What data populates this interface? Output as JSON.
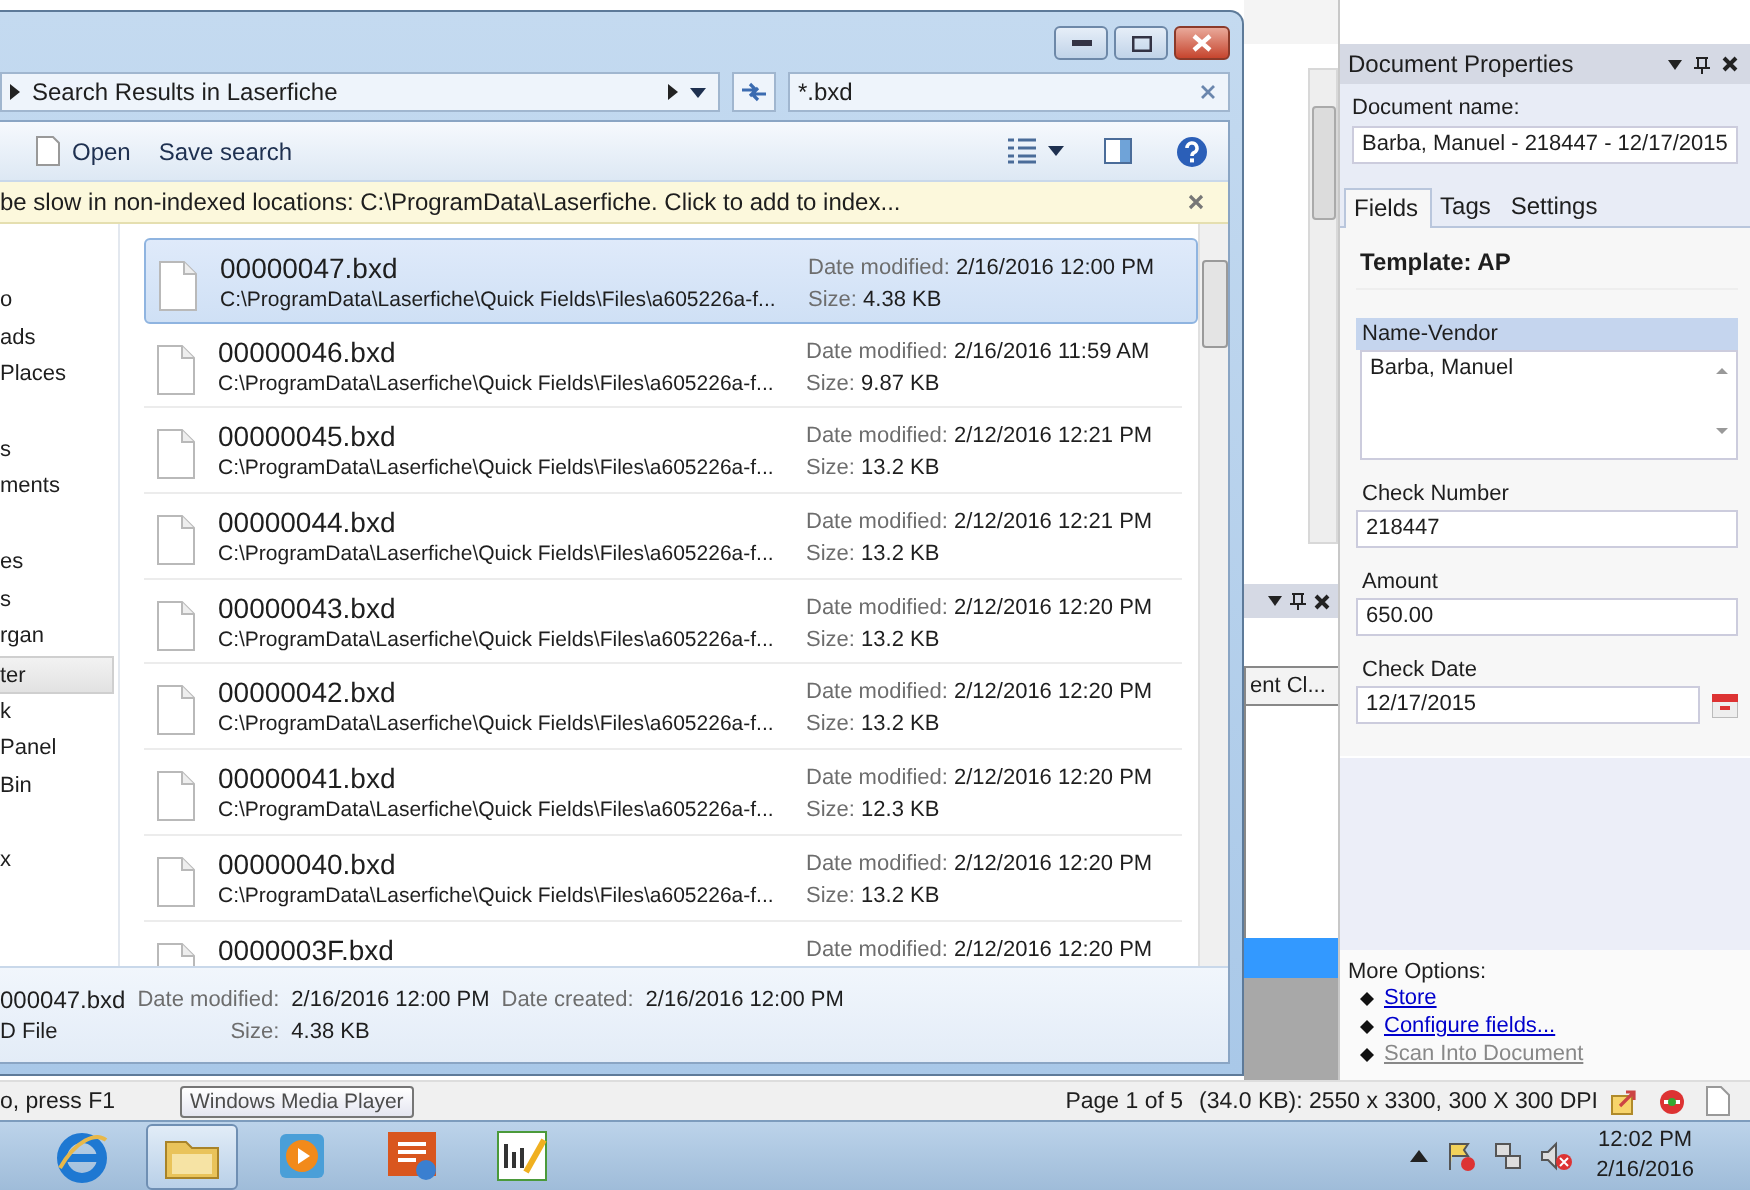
{
  "explorer": {
    "breadcrumb": "Search Results in Laserfiche",
    "search": {
      "value": "*.bxd"
    },
    "toolbar": [
      {
        "label": "Open",
        "kind": "open"
      },
      {
        "label": "Save search",
        "kind": "plain"
      }
    ],
    "info_bar": "be slow in non-indexed locations: C:\\ProgramData\\Laserfiche. Click to add to index...",
    "nav_groups": [
      {
        "items": [
          {
            "label": "o",
            "selected": false
          },
          {
            "label": "ads",
            "selected": false
          },
          {
            "label": "Places",
            "selected": false
          }
        ]
      },
      {
        "items": [
          {
            "label": "s",
            "selected": false
          },
          {
            "label": "ments",
            "selected": false
          }
        ]
      },
      {
        "items": [
          {
            "label": "es",
            "selected": false
          },
          {
            "label": "s",
            "selected": false
          },
          {
            "label": "rgan",
            "selected": false
          },
          {
            "label": "ter",
            "selected": true
          },
          {
            "label": "k",
            "selected": false
          },
          {
            "label": "Panel",
            "selected": false
          },
          {
            "label": "Bin",
            "selected": false
          }
        ]
      },
      {
        "items": [
          {
            "label": "x",
            "selected": false
          }
        ]
      }
    ],
    "files": [
      {
        "name": "00000047.bxd",
        "path": "C:\\ProgramData\\Laserfiche\\Quick Fields\\Files\\a605226a-f...",
        "date_label": "Date modified:",
        "date": "2/16/2016 12:00 PM",
        "size_label": "Size:",
        "size": "4.38 KB",
        "selected": true
      },
      {
        "name": "00000046.bxd",
        "path": "C:\\ProgramData\\Laserfiche\\Quick Fields\\Files\\a605226a-f...",
        "date_label": "Date modified:",
        "date": "2/16/2016 11:59 AM",
        "size_label": "Size:",
        "size": "9.87 KB",
        "selected": false
      },
      {
        "name": "00000045.bxd",
        "path": "C:\\ProgramData\\Laserfiche\\Quick Fields\\Files\\a605226a-f...",
        "date_label": "Date modified:",
        "date": "2/12/2016 12:21 PM",
        "size_label": "Size:",
        "size": "13.2 KB",
        "selected": false
      },
      {
        "name": "00000044.bxd",
        "path": "C:\\ProgramData\\Laserfiche\\Quick Fields\\Files\\a605226a-f...",
        "date_label": "Date modified:",
        "date": "2/12/2016 12:21 PM",
        "size_label": "Size:",
        "size": "13.2 KB",
        "selected": false
      },
      {
        "name": "00000043.bxd",
        "path": "C:\\ProgramData\\Laserfiche\\Quick Fields\\Files\\a605226a-f...",
        "date_label": "Date modified:",
        "date": "2/12/2016 12:20 PM",
        "size_label": "Size:",
        "size": "13.2 KB",
        "selected": false
      },
      {
        "name": "00000042.bxd",
        "path": "C:\\ProgramData\\Laserfiche\\Quick Fields\\Files\\a605226a-f...",
        "date_label": "Date modified:",
        "date": "2/12/2016 12:20 PM",
        "size_label": "Size:",
        "size": "13.2 KB",
        "selected": false
      },
      {
        "name": "00000041.bxd",
        "path": "C:\\ProgramData\\Laserfiche\\Quick Fields\\Files\\a605226a-f...",
        "date_label": "Date modified:",
        "date": "2/12/2016 12:20 PM",
        "size_label": "Size:",
        "size": "12.3 KB",
        "selected": false
      },
      {
        "name": "00000040.bxd",
        "path": "C:\\ProgramData\\Laserfiche\\Quick Fields\\Files\\a605226a-f...",
        "date_label": "Date modified:",
        "date": "2/12/2016 12:20 PM",
        "size_label": "Size:",
        "size": "13.2 KB",
        "selected": false
      },
      {
        "name": "0000003F.bxd",
        "date_label": "Date modified:",
        "date": "2/12/2016 12:20 PM",
        "selected": false
      }
    ],
    "details": {
      "name": "000047.bxd",
      "type": "D File",
      "fields": [
        {
          "label": "Date modified:",
          "value": "2/16/2016 12:00 PM"
        },
        {
          "label": "Size:",
          "value": "4.38 KB"
        },
        {
          "label": "Date created:",
          "value": "2/16/2016 12:00 PM"
        }
      ]
    }
  },
  "background_app": {
    "column_header": "ent Cl..."
  },
  "doc_properties": {
    "title": "Document Properties",
    "name_label": "Document name:",
    "name_value": "Barba, Manuel - 218447 - 12/17/2015",
    "tabs": [
      {
        "label": "Fields",
        "selected": true
      },
      {
        "label": "Tags",
        "selected": false
      },
      {
        "label": "Settings",
        "selected": false
      }
    ],
    "template": "Template: AP",
    "fields": [
      {
        "kind": "multiline",
        "label": "Name-Vendor",
        "value": "Barba, Manuel",
        "selected": true
      },
      {
        "kind": "text",
        "label": "Check Number",
        "value": "218447",
        "selected": false
      },
      {
        "kind": "text",
        "label": "Amount",
        "value": "650.00",
        "selected": false
      },
      {
        "kind": "date",
        "label": "Check Date",
        "value": "12/17/2015",
        "selected": false
      }
    ],
    "more_options_label": "More Options:",
    "links": [
      {
        "label": "Store",
        "disabled": false
      },
      {
        "label": "Configure fields...",
        "disabled": false
      },
      {
        "label": "Scan Into Document",
        "disabled": true
      }
    ]
  },
  "status_bar": {
    "hint": "o, press F1",
    "tooltip": "Windows Media Player",
    "page": "Page 1 of 5",
    "info": "(34.0 KB): 2550 x 3300, 300 X 300 DPI"
  },
  "taskbar": {
    "apps": [
      {
        "kind": "browser",
        "active": false
      },
      {
        "kind": "folder",
        "active": true
      },
      {
        "kind": "media",
        "active": false
      },
      {
        "kind": "slides",
        "active": false
      },
      {
        "kind": "editor",
        "active": false
      }
    ],
    "time": "12:02 PM",
    "date": "2/16/2016"
  }
}
